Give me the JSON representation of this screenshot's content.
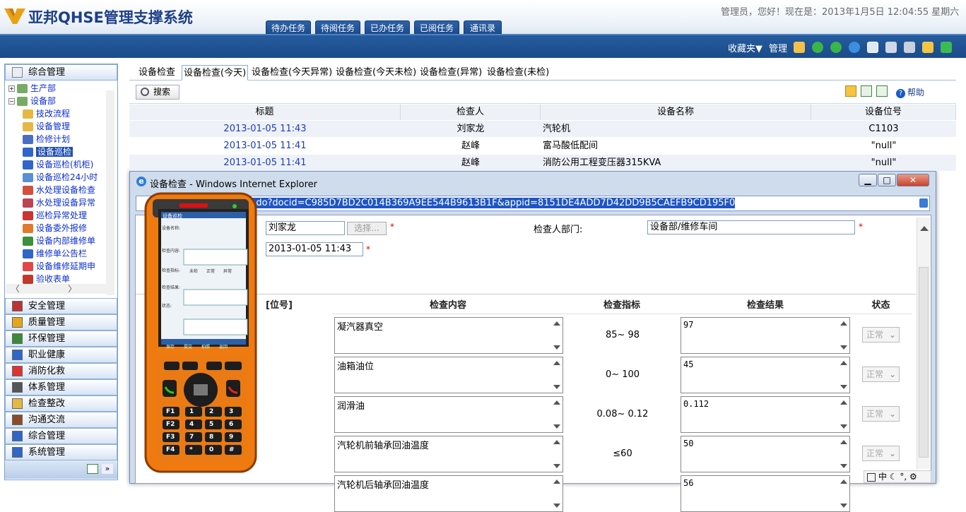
{
  "app": {
    "title": "亚邦QHSE管理支撑系统",
    "user_info": "管理员，您好！现在是：2013年1月5日 12:04:55 星期六",
    "top_tabs": [
      "待办任务",
      "待阅任务",
      "已办任务",
      "已阅任务",
      "通讯录"
    ],
    "favorites": "收藏夹▼",
    "manage": "管理"
  },
  "sidebar": {
    "header": "综合管理",
    "tree": [
      {
        "label": "生产部",
        "level": 0
      },
      {
        "label": "设备部",
        "level": 0
      },
      {
        "label": "技改流程",
        "level": 1
      },
      {
        "label": "设备管理",
        "level": 1
      },
      {
        "label": "检修计划",
        "level": 1
      },
      {
        "label": "设备巡检",
        "level": 1,
        "selected": true
      },
      {
        "label": "设备巡检(机柜)",
        "level": 1
      },
      {
        "label": "设备巡检24小时",
        "level": 1
      },
      {
        "label": "水处理设备检查",
        "level": 1
      },
      {
        "label": "水处理设备异常",
        "level": 1
      },
      {
        "label": "巡检异常处理",
        "level": 1
      },
      {
        "label": "设备委外报修",
        "level": 1
      },
      {
        "label": "设备内部维修单",
        "level": 1
      },
      {
        "label": "维修单公告栏",
        "level": 1
      },
      {
        "label": "设备维修延期申",
        "level": 1
      },
      {
        "label": "验收表单",
        "level": 1
      }
    ],
    "sections": [
      "安全管理",
      "质量管理",
      "环保管理",
      "职业健康",
      "消防化救",
      "体系管理",
      "检查整改",
      "沟通交流",
      "综合管理",
      "系统管理"
    ]
  },
  "main": {
    "tabs": [
      "设备检查",
      "设备检查(今天)",
      "设备检查(今天异常)",
      "设备检查(今天未检)",
      "设备检查(异常)",
      "设备检查(未检)"
    ],
    "active_tab": 1,
    "search_label": "搜索",
    "help_label": "帮助",
    "columns": [
      "标题",
      "检查人",
      "设备名称",
      "设备位号"
    ],
    "rows": [
      {
        "title": "2013-01-05 11:43",
        "inspector": "刘家龙",
        "device": "汽轮机",
        "tag": "C1103"
      },
      {
        "title": "2013-01-05 11:41",
        "inspector": "赵峰",
        "device": "富马酸低配间",
        "tag": "\"null\""
      },
      {
        "title": "2013-01-05 11:41",
        "inspector": "赵峰",
        "device": "消防公用工程变压器315KVA",
        "tag": "\"null\""
      }
    ]
  },
  "popup": {
    "title": "设备检查 - Windows Internet Explorer",
    "url_prefix": "hse/app/openAppDoc.do?docid=C985D7BD2C014B369A9EE544B9613B1F&appid=8151DE4ADD7D42DD9B5CAEFB9CD195F0",
    "inspector_value": "刘家龙",
    "select_button": "选择...",
    "dept_label": "检查人部门:",
    "dept_value": "设备部/维修车间",
    "time_value": "2013-01-05 11:43",
    "detail_columns": [
      "[位号]",
      "检查内容",
      "检查指标",
      "检查结果",
      "状态"
    ],
    "items": [
      {
        "content": "凝汽器真空",
        "indicator": "85~ 98",
        "result": "97",
        "status": "正常"
      },
      {
        "content": "油箱油位",
        "indicator": "0~ 100",
        "result": "45",
        "status": "正常"
      },
      {
        "content": "润滑油",
        "indicator": "0.08~ 0.12",
        "result": "0.112",
        "status": "正常"
      },
      {
        "content": "汽轮机前轴承回油温度",
        "indicator": "≤60",
        "result": "50",
        "status": "正常"
      },
      {
        "content": "汽轮机后轴承回油温度",
        "indicator": "",
        "result": "56",
        "status": ""
      }
    ],
    "ime": "中"
  },
  "phone": {
    "screen_title": "设备巡检",
    "lines": [
      "设备名称:",
      "检查内容:",
      "检查指标:",
      "检查结果:",
      "状态:"
    ],
    "radio_options": [
      "未检",
      "正常",
      "异常"
    ],
    "softkeys": [
      "保存",
      "提交",
      "拍照",
      "返回"
    ],
    "fkeys": [
      "F1",
      "F2",
      "F3",
      "F4"
    ],
    "numkeys": [
      "1",
      "2",
      "3",
      "4",
      "5",
      "6",
      "7",
      "8",
      "9",
      "*",
      "0",
      "#"
    ]
  },
  "colors": {
    "accent": "#1b4b8a",
    "link": "#1a3cc0",
    "phone_body": "#ef7a10"
  }
}
